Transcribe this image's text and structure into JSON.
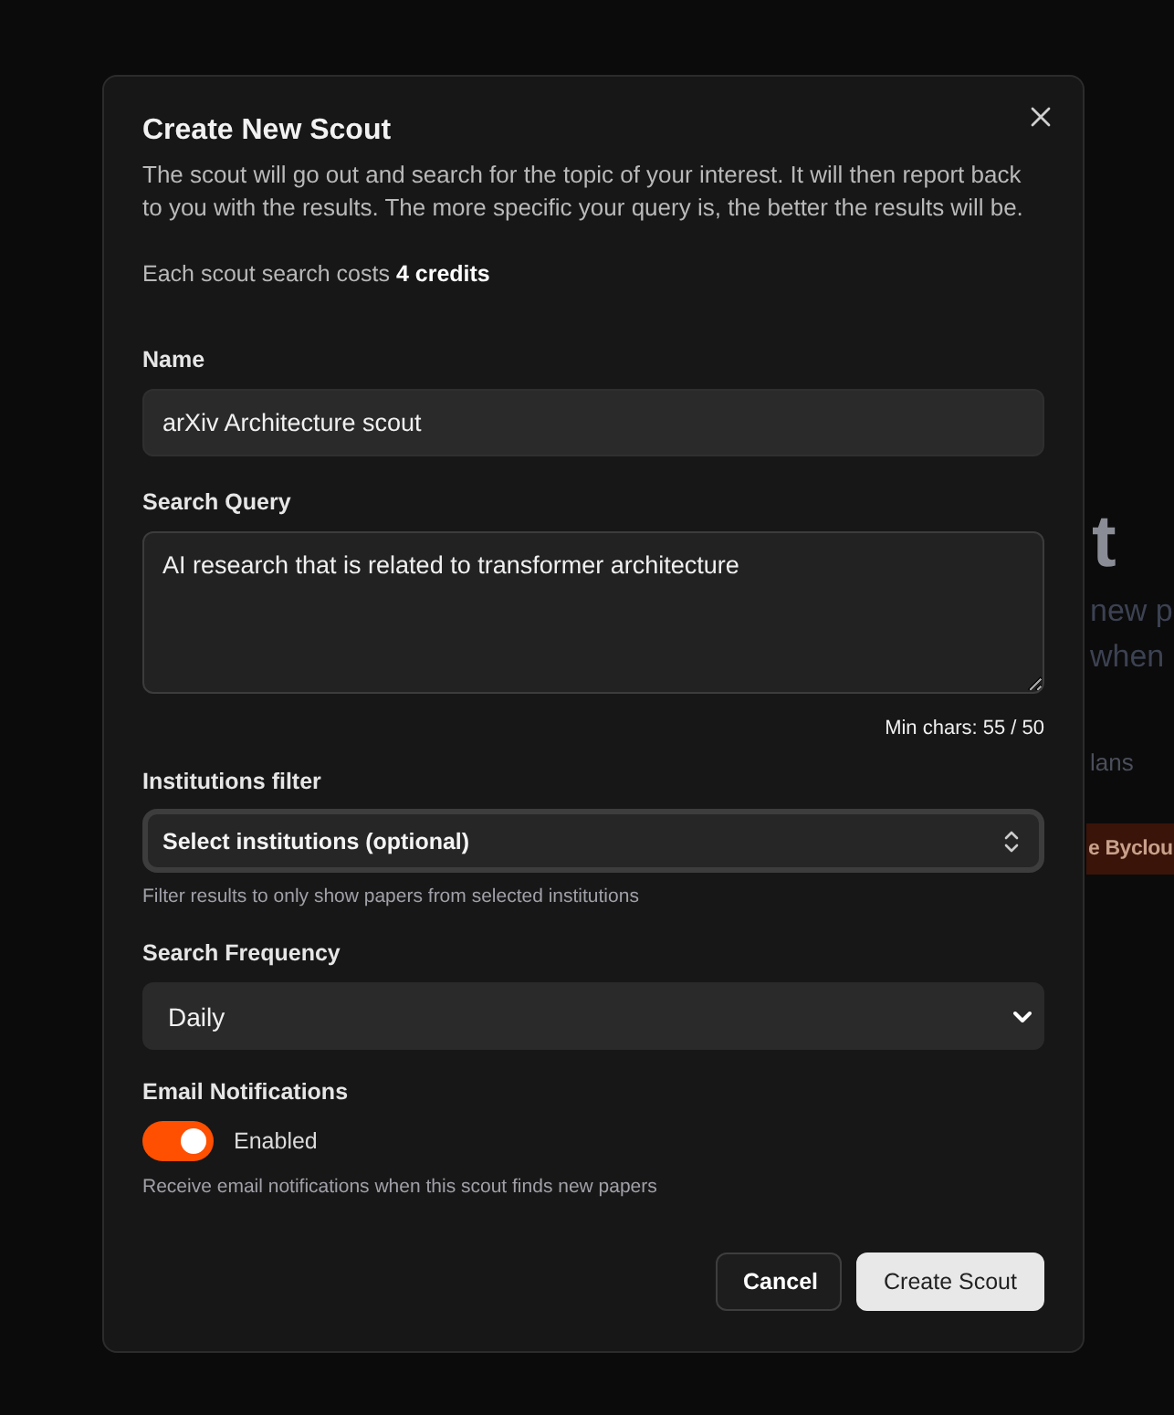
{
  "background": {
    "heading_fragment": "t",
    "text_lines": [
      "new p",
      "when"
    ],
    "link_fragment": "lans",
    "button_fragment": "e Byclou"
  },
  "dialog": {
    "title": "Create New Scout",
    "description": "The scout will go out and search for the topic of your interest. It will then report back to you with the results. The more specific your query is, the better the results will be.",
    "cost_note": "Each scout search costs **4 credits**",
    "fields": [
      {
        "kind": "text",
        "label": "Name",
        "value": "arXiv Architecture scout"
      },
      {
        "kind": "textarea",
        "label": "Search Query",
        "value": "AI research that is related to transformer architecture",
        "counter": "Min chars: 55 / 50"
      },
      {
        "kind": "combobox",
        "label": "Institutions filter",
        "placeholder": "Select institutions (optional)",
        "hint": "Filter results to only show papers from selected institutions"
      },
      {
        "kind": "select",
        "label": "Search Frequency",
        "value": "Daily"
      },
      {
        "kind": "toggle",
        "label": "Email Notifications",
        "on": true,
        "state_label": "Enabled",
        "hint": "Receive email notifications when this scout finds new papers"
      }
    ],
    "buttons": [
      {
        "kind": "secondary",
        "label": "Cancel"
      },
      {
        "kind": "primary",
        "label": "Create Scout"
      }
    ]
  }
}
